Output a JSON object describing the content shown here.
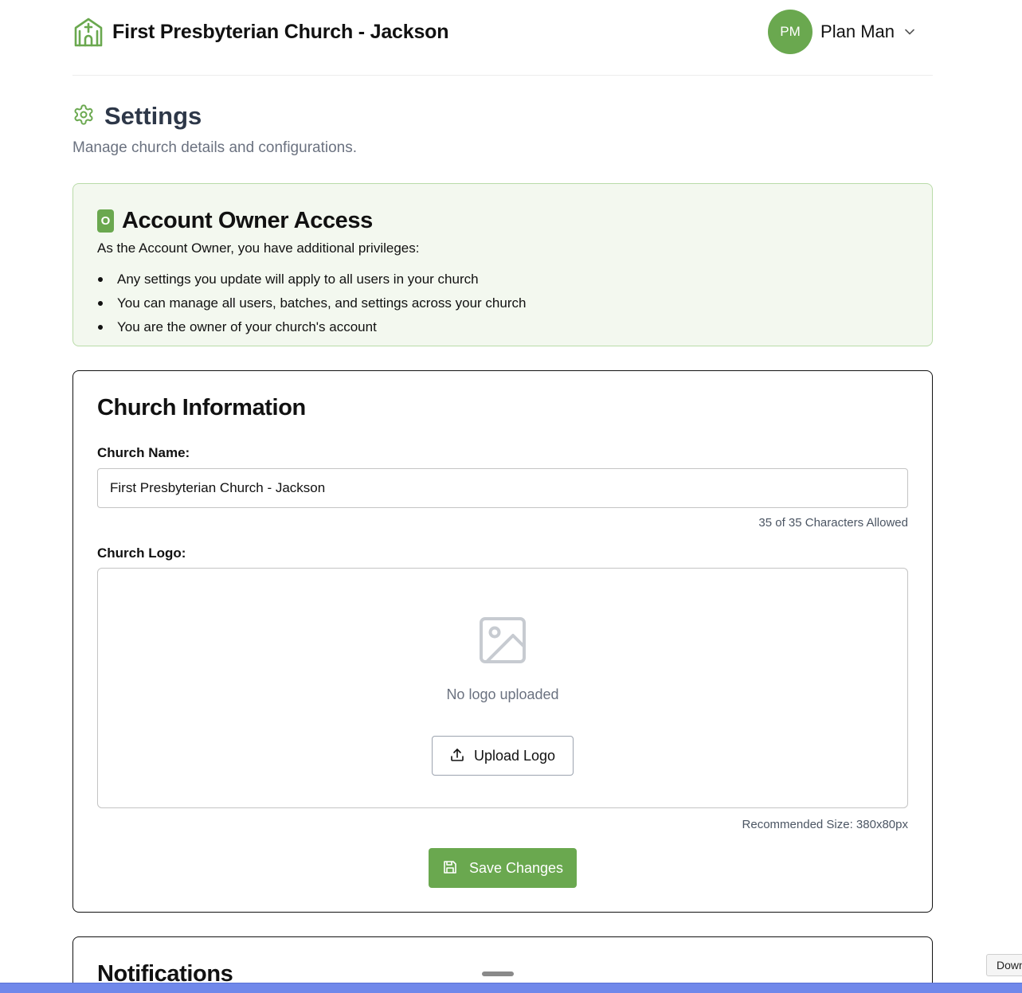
{
  "header": {
    "church_name": "First Presbyterian Church - Jackson",
    "brand_icon": "church-icon",
    "user": {
      "initials": "PM",
      "name": "Plan Man",
      "menu_icon": "chevron-down-icon"
    }
  },
  "page": {
    "title": "Settings",
    "title_icon": "gear-icon",
    "subtitle": "Manage church details and configurations."
  },
  "owner_access": {
    "badge": "O",
    "title": "Account Owner Access",
    "intro": "As the Account Owner, you have additional privileges:",
    "items": [
      "Any settings you update will apply to all users in your church",
      "You can manage all users, batches, and settings across your church",
      "You are the owner of your church's account"
    ]
  },
  "church_info": {
    "title": "Church Information",
    "name_label": "Church Name:",
    "name_value": "First Presbyterian Church - Jackson",
    "char_count": "35 of 35 Characters Allowed",
    "logo_label": "Church Logo:",
    "no_logo_text": "No logo uploaded",
    "upload_label": "Upload Logo",
    "recommended_size": "Recommended Size: 380x80px",
    "save_label": "Save Changes"
  },
  "notifications": {
    "title": "Notifications"
  },
  "download_chip": "Down",
  "colors": {
    "accent": "#6aa84f",
    "owner_bg": "#f3f8ef",
    "owner_border": "#b9dba8",
    "title_text": "#2d3748",
    "muted_text": "#6b7280",
    "bottom_bar": "#7088ea"
  }
}
